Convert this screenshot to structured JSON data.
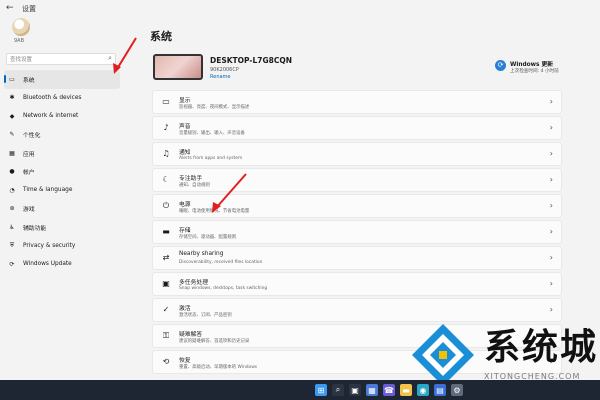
{
  "window": {
    "back_icon": "back-arrow-icon",
    "title": "设置"
  },
  "sidebar": {
    "user_name": "9AB",
    "search_placeholder": "查找设置",
    "items": [
      {
        "label": "系统",
        "icon": "▭",
        "active": true
      },
      {
        "label": "Bluetooth & devices",
        "icon": "✱"
      },
      {
        "label": "Network & internet",
        "icon": "◆"
      },
      {
        "label": "个性化",
        "icon": "✎"
      },
      {
        "label": "应用",
        "icon": "▦"
      },
      {
        "label": "帐户",
        "icon": "●"
      },
      {
        "label": "Time & language",
        "icon": "◔"
      },
      {
        "label": "游戏",
        "icon": "⊛"
      },
      {
        "label": "辅助功能",
        "icon": "♿"
      },
      {
        "label": "Privacy & security",
        "icon": "⛨"
      },
      {
        "label": "Windows Update",
        "icon": "⟳"
      }
    ]
  },
  "main": {
    "title": "系统",
    "device": {
      "name": "DESKTOP-L7G8CQN",
      "id": "90K2006CP",
      "rename": "Rename"
    },
    "update": {
      "title": "Windows 更新",
      "subtitle": "上次检查时间: 4 小时前"
    },
    "rows": [
      {
        "title": "显示",
        "subtitle": "监视器、亮度、夜间模式、显示描述",
        "icon": "▭"
      },
      {
        "title": "声音",
        "subtitle": "音量级别、输出、输入、声音设备",
        "icon": "♪"
      },
      {
        "title": "通知",
        "subtitle": "Alerts from apps and system",
        "icon": "♫"
      },
      {
        "title": "专注助手",
        "subtitle": "通知、自动规则",
        "icon": "☾"
      },
      {
        "title": "电源",
        "subtitle": "睡眠、电池使用情况、节省电池电量",
        "icon": "⏻"
      },
      {
        "title": "存储",
        "subtitle": "存储空间、驱动器、配置规则",
        "icon": "▬"
      },
      {
        "title": "Nearby sharing",
        "subtitle": "Discoverability, received files location",
        "icon": "⇄"
      },
      {
        "title": "多任务处理",
        "subtitle": "Snap windows, desktops, task switching",
        "icon": "▣"
      },
      {
        "title": "激活",
        "subtitle": "激活状态、订阅、产品密钥",
        "icon": "✓"
      },
      {
        "title": "疑难解答",
        "subtitle": "建议的疑难解答、首选项和历史记录",
        "icon": "⚿"
      },
      {
        "title": "恢复",
        "subtitle": "重置、高级启动、早期版本的 Windows",
        "icon": "⟲"
      }
    ]
  },
  "watermark": {
    "text": "系统城",
    "url": "XITONGCHENG.COM"
  },
  "taskbar": {
    "icons": [
      {
        "name": "start-icon",
        "glyph": "⊞",
        "color": "#3a9bf0"
      },
      {
        "name": "search-icon",
        "glyph": "⌕",
        "color": "#2c3442"
      },
      {
        "name": "task-view-icon",
        "glyph": "▣",
        "color": "#2c3442"
      },
      {
        "name": "widgets-icon",
        "glyph": "▦",
        "color": "#4b7bd6"
      },
      {
        "name": "teams-icon",
        "glyph": "☎",
        "color": "#6b5bd6"
      },
      {
        "name": "explorer-icon",
        "glyph": "▬",
        "color": "#f2c24b"
      },
      {
        "name": "edge-icon",
        "glyph": "◉",
        "color": "#2aa6c9"
      },
      {
        "name": "store-icon",
        "glyph": "▤",
        "color": "#3a6fd8"
      },
      {
        "name": "settings-icon",
        "glyph": "⚙",
        "color": "#5f6b7a"
      }
    ]
  },
  "colors": {
    "accent": "#0067c0",
    "arrow": "#e02020",
    "taskbar": "#1e2633"
  }
}
